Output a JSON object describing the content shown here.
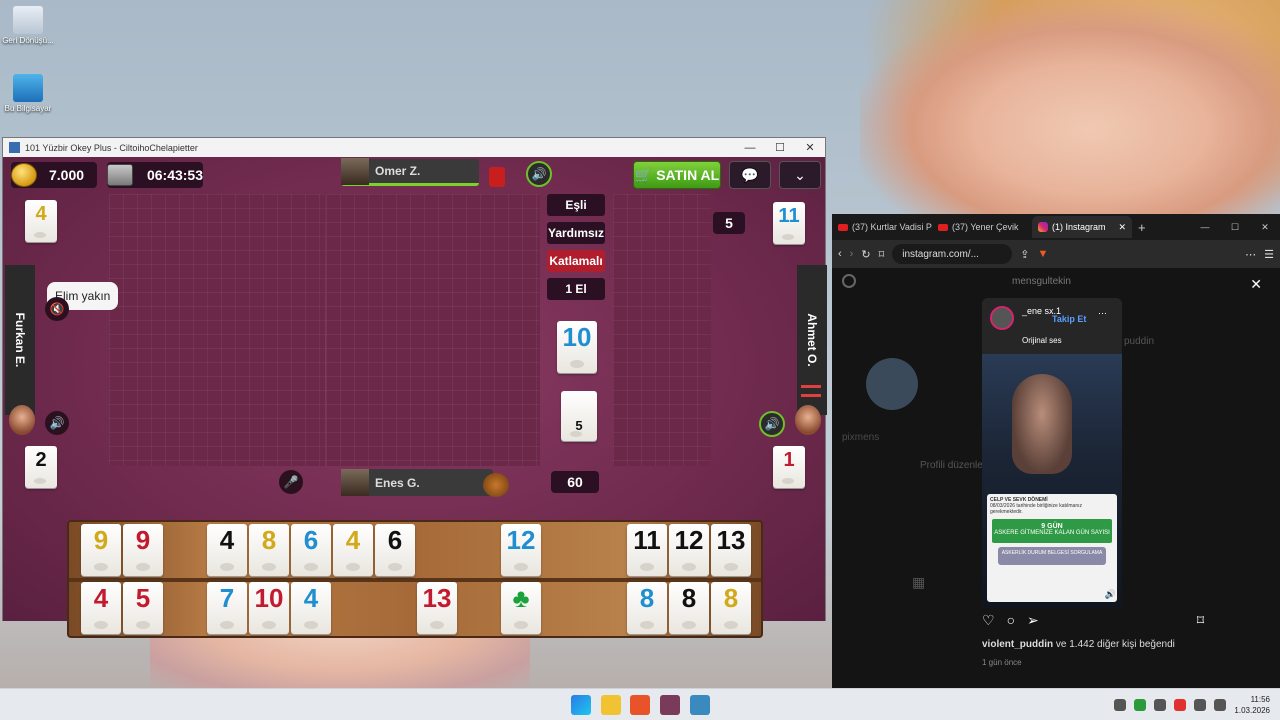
{
  "desktop": {
    "icons": [
      {
        "label": "Geri Dönüşü..."
      },
      {
        "label": "Bu Bilgisayar"
      }
    ]
  },
  "game_window": {
    "title": "101 Yüzbir Okey Plus - CiltoihoChelapietter",
    "controls": {
      "minimize": "—",
      "maximize": "☐",
      "close": "✕"
    },
    "coins": "7.000",
    "timer": "06:43:53",
    "top_player": "Omer Z.",
    "buy_label": "SATIN AL",
    "modes": [
      "Eşli",
      "Yardımsız",
      "Katlamalı",
      "1 El"
    ],
    "left_player": "Furkan E.",
    "right_player": "Ahmet O.",
    "bottom_player": "Enes G.",
    "speech": "Elim yakın",
    "badge_top_right": "5",
    "badge_bottom": "60",
    "indicator_tiles": {
      "top_left": "4",
      "bottom_left": "2",
      "top_right": "11",
      "bottom_right": "1",
      "center_top": "10",
      "center_bottom": "5"
    },
    "rack_top": [
      {
        "v": "9",
        "c": "yellow"
      },
      {
        "v": "9",
        "c": "red"
      },
      {
        "v": "4",
        "c": "black"
      },
      {
        "v": "8",
        "c": "yellow"
      },
      {
        "v": "6",
        "c": "blue"
      },
      {
        "v": "4",
        "c": "yellow"
      },
      {
        "v": "6",
        "c": "black"
      },
      {
        "v": "12",
        "c": "blue"
      },
      {
        "v": "11",
        "c": "black"
      },
      {
        "v": "12",
        "c": "black"
      },
      {
        "v": "13",
        "c": "black"
      }
    ],
    "rack_bottom": [
      {
        "v": "4",
        "c": "red"
      },
      {
        "v": "5",
        "c": "red"
      },
      {
        "v": "7",
        "c": "blue"
      },
      {
        "v": "10",
        "c": "red"
      },
      {
        "v": "4",
        "c": "blue"
      },
      {
        "v": "13",
        "c": "red"
      },
      {
        "v": "♣",
        "c": "green"
      },
      {
        "v": "8",
        "c": "blue"
      },
      {
        "v": "8",
        "c": "black"
      },
      {
        "v": "8",
        "c": "yellow"
      }
    ],
    "colors": {
      "yellow": "#d1a91a",
      "red": "#c21a2e",
      "blue": "#1f8fd1",
      "black": "#111111",
      "green": "#1aa33a"
    }
  },
  "browser": {
    "tabs": [
      {
        "label": "(37) Kurtlar Vadisi P"
      },
      {
        "label": "(37) Yener Çevik"
      },
      {
        "label": "(1) Instagram"
      }
    ],
    "url": "instagram.com/...",
    "profile_name": "mensgultekin",
    "card_user": "_ene sx.1",
    "follow": "Takip Et",
    "audio": "Orijinal ses",
    "bg_link": "puddin",
    "profile_edit": "Profili düzenle",
    "pixmens": "pixmens",
    "doc_title": "CELP VE SEVK DÖNEMİ",
    "doc_text": "08/03/2026 tarihinde birliğinize katılmanız gerekmektedir.",
    "green_count": "9 GÜN",
    "green_sub": "ASKERE GİTMENİZE KALAN GÜN SAYISI",
    "grey_btn": "ASKERLİK DURUM BELGESİ SORGULAMA",
    "likes_user": "violent_puddin",
    "likes_text": "ve 1.442 diğer kişi beğendi",
    "time_ago": "1 gün önce"
  },
  "taskbar": {
    "time": "11:56",
    "date": "1.03.2026"
  }
}
